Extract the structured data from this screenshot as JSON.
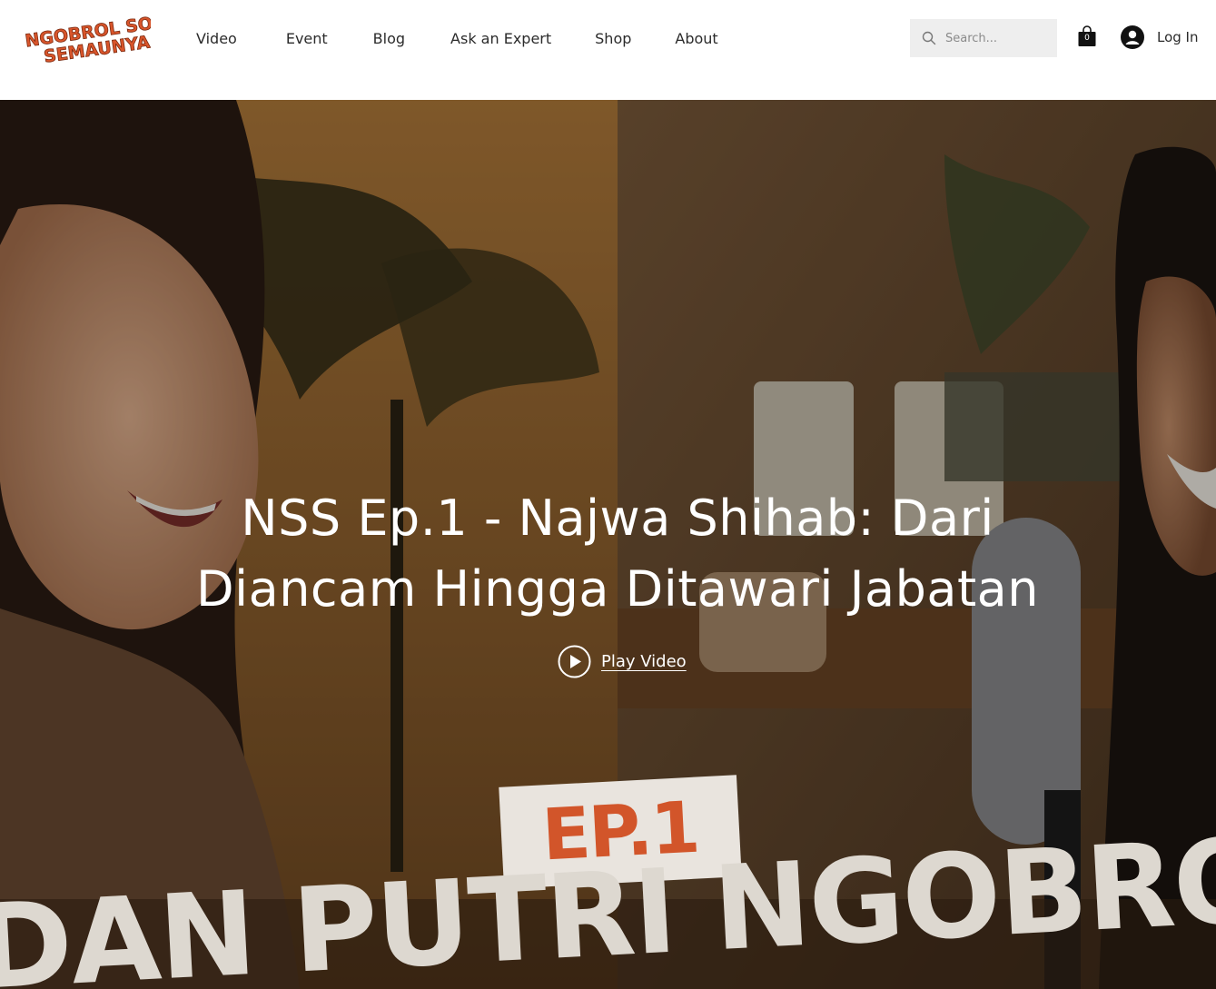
{
  "brand": {
    "logo_text_line1": "NGOBROL SORE",
    "logo_text_line2": "SEMAUNYA",
    "logo_color": "#d9552b"
  },
  "nav": {
    "items": [
      {
        "label": "Video"
      },
      {
        "label": "Event"
      },
      {
        "label": "Blog"
      },
      {
        "label": "Ask an Expert"
      },
      {
        "label": "Shop"
      },
      {
        "label": "About"
      }
    ]
  },
  "search": {
    "placeholder": "Search...",
    "icon": "search-icon"
  },
  "cart": {
    "count": "0",
    "icon": "shopping-bag-icon"
  },
  "account": {
    "login_label": "Log In",
    "icon": "user-avatar-icon"
  },
  "hero": {
    "title": "NSS Ep.1 - Najwa Shihab: Dari Diancam Hingga Ditawari Jabatan",
    "play_label": "Play Video",
    "play_icon": "play-circle-icon",
    "thumbnail_tag": "EP.1",
    "thumbnail_banner": "DAN PUTRI NGOBROL TE",
    "accent_color": "#d2552a"
  }
}
